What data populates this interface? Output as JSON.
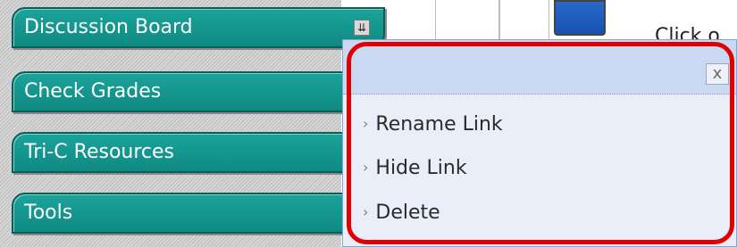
{
  "sidebar": {
    "items": [
      {
        "label": "Discussion Board",
        "has_menu": true
      },
      {
        "label": "Check Grades"
      },
      {
        "label": "Tri-C Resources"
      },
      {
        "label": "Tools"
      }
    ],
    "menu_icon": "chevron-double-down-icon"
  },
  "top": {
    "instruction_text": "Click o"
  },
  "context_menu": {
    "close_label": "x",
    "items": [
      {
        "label": "Rename Link"
      },
      {
        "label": "Hide Link"
      },
      {
        "label": "Delete"
      }
    ],
    "highlight_color": "#e00000"
  }
}
